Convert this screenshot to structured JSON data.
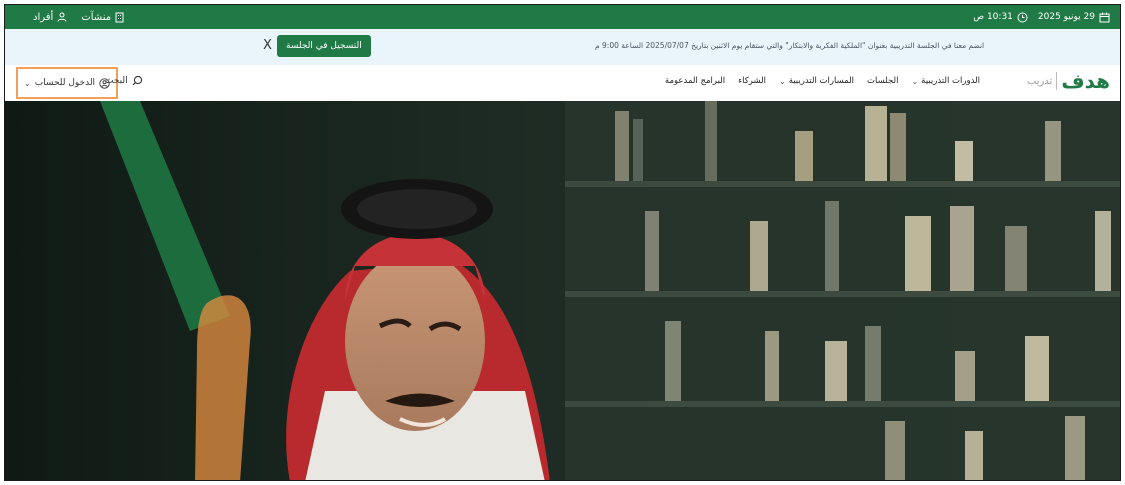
{
  "topbar": {
    "date": "29 يونيو 2025",
    "time": "10:31 ص",
    "links": [
      {
        "label": "أفراد",
        "icon": "person-icon"
      },
      {
        "label": "منشآت",
        "icon": "building-icon"
      }
    ]
  },
  "notice": {
    "message": "انضم معنا في الجلسة التدريبية بعنوان \"الملكية الفكرية والابتكار\" والتي ستقام يوم الاثنين بتاريخ 2025/07/07 الساعة 9:00 م",
    "register_label": "التسجيل في الجلسة",
    "close_label": "X"
  },
  "nav": {
    "logo_text": "هدف",
    "logo_sub": "تدريب",
    "menu": [
      {
        "label": "الدورات التدريبية",
        "has_dropdown": true
      },
      {
        "label": "الجلسات",
        "has_dropdown": false
      },
      {
        "label": "المسارات التدريبية",
        "has_dropdown": true
      },
      {
        "label": "الشركاء",
        "has_dropdown": false
      },
      {
        "label": "البرامج المدعومة",
        "has_dropdown": false
      }
    ],
    "search_label": "البحث",
    "login_label": "الدخول للحساب"
  },
  "colors": {
    "brand_green": "#1f7a45",
    "accent_orange": "#f0a058",
    "notice_bg": "#e9f4fb"
  }
}
